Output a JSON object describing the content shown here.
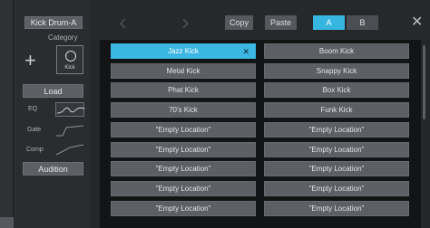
{
  "sidebar": {
    "preset_name": "Kick Drum-A",
    "category_label": "Category",
    "category_value": "Kick",
    "load_label": "Load",
    "eq_label": "EQ",
    "gate_label": "Gate",
    "comp_label": "Comp",
    "audition_label": "Audition"
  },
  "toolbar": {
    "copy_label": "Copy",
    "paste_label": "Paste",
    "a_label": "A",
    "b_label": "B"
  },
  "slots": [
    "Jazz Kick",
    "Boom Kick",
    "Metal Kick",
    "Snappy Kick",
    "Phat Kick",
    "Box Kick",
    "70's Kick",
    "Funk Kick",
    "\"Empty Location\"",
    "\"Empty Location\"",
    "\"Empty Location\"",
    "\"Empty Location\"",
    "\"Empty Location\"",
    "\"Empty Location\"",
    "\"Empty Location\"",
    "\"Empty Location\"",
    "\"Empty Location\"",
    "\"Empty Location\""
  ],
  "selected_slot_index": 0,
  "colors": {
    "accent": "#3bb7e3"
  },
  "icons": {
    "add": "plus-icon",
    "category": "circle-icon",
    "prev": "chevron-left-icon",
    "next": "chevron-right-icon",
    "close": "close-icon",
    "deselect": "close-icon"
  }
}
